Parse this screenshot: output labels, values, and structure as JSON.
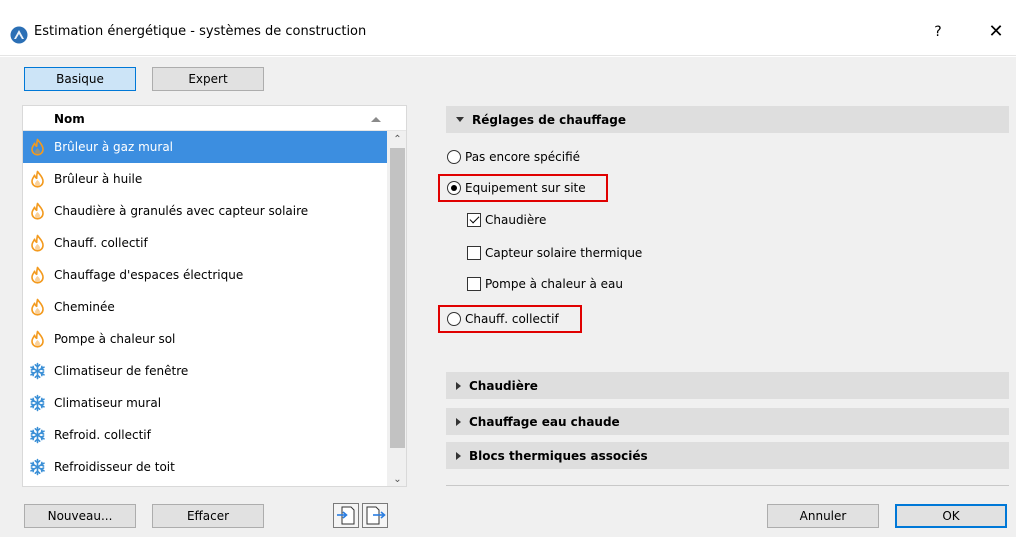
{
  "window": {
    "title": "Estimation énergétique - systèmes de construction",
    "help": "?",
    "close": "✕"
  },
  "mode_tabs": {
    "basic": "Basique",
    "expert": "Expert"
  },
  "list": {
    "column_header": "Nom",
    "items": [
      {
        "label": "Brûleur à gaz mural",
        "icon": "flame-icon",
        "selected": true
      },
      {
        "label": "Brûleur à huile",
        "icon": "flame-icon"
      },
      {
        "label": "Chaudière à granulés avec capteur solaire",
        "icon": "flame-icon"
      },
      {
        "label": "Chauff. collectif",
        "icon": "flame-icon"
      },
      {
        "label": "Chauffage d'espaces électrique",
        "icon": "flame-icon"
      },
      {
        "label": "Cheminée",
        "icon": "flame-icon"
      },
      {
        "label": "Pompe à chaleur sol",
        "icon": "flame-icon"
      },
      {
        "label": "Climatiseur de fenêtre",
        "icon": "snowflake-icon"
      },
      {
        "label": "Climatiseur mural",
        "icon": "snowflake-icon"
      },
      {
        "label": "Refroid. collectif",
        "icon": "snowflake-icon"
      },
      {
        "label": "Refroidisseur de toit",
        "icon": "snowflake-icon"
      }
    ]
  },
  "list_actions": {
    "new": "Nouveau...",
    "delete": "Effacer"
  },
  "heating_settings": {
    "header": "Réglages de chauffage",
    "options": [
      {
        "label": "Pas encore spécifié",
        "checked": false
      },
      {
        "label": "Equipement sur site",
        "checked": true
      },
      {
        "label": "Chauff. collectif",
        "checked": false
      }
    ],
    "equipment": [
      {
        "label": "Chaudière",
        "checked": true
      },
      {
        "label": "Capteur solaire thermique",
        "checked": false
      },
      {
        "label": "Pompe à chaleur à eau",
        "checked": false
      }
    ]
  },
  "collapsed_sections": [
    "Chaudière",
    "Chauffage eau chaude",
    "Blocs thermiques associés"
  ],
  "dialog_buttons": {
    "cancel": "Annuler",
    "ok": "OK"
  },
  "colors": {
    "selection": "#3c8ee0",
    "flame": "#f39a1e",
    "snowflake": "#3a8fd6",
    "highlight": "#e00000",
    "default_button": "#0078d7"
  }
}
